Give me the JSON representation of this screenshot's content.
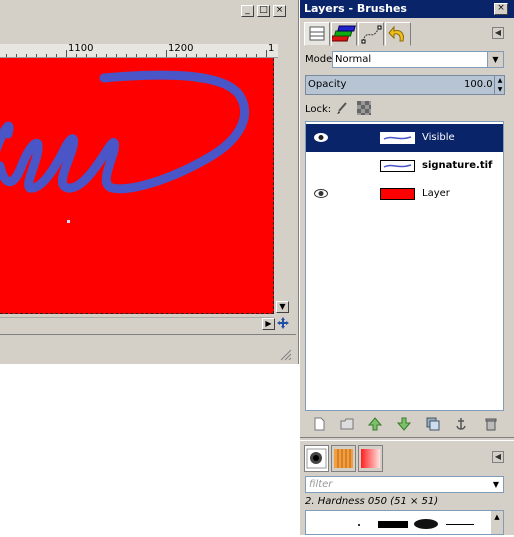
{
  "canvas": {
    "ruler_labels": [
      "1100",
      "1200",
      "1"
    ],
    "window_buttons": [
      "_",
      "□",
      "×"
    ]
  },
  "dock": {
    "title": "Layers - Brushes",
    "close_label": "×",
    "mode_label": "Mode:",
    "mode_value": "Normal",
    "opacity_label": "Opacity",
    "opacity_value": "100.0",
    "lock_label": "Lock:",
    "layers": [
      {
        "name": "Visible",
        "visible": true,
        "selected": true,
        "bold": false
      },
      {
        "name": "signature.tif",
        "visible": false,
        "selected": false,
        "bold": true
      },
      {
        "name": "Layer",
        "visible": true,
        "selected": false,
        "bold": false
      }
    ],
    "filter_placeholder": "filter",
    "brush_name": "2. Hardness 050 (51 × 51)"
  },
  "colors": {
    "layer_fill": "#ff0000",
    "signature_ink": "#4a55c8",
    "title_bar": "#0a246a",
    "selection": "#0a246a"
  }
}
